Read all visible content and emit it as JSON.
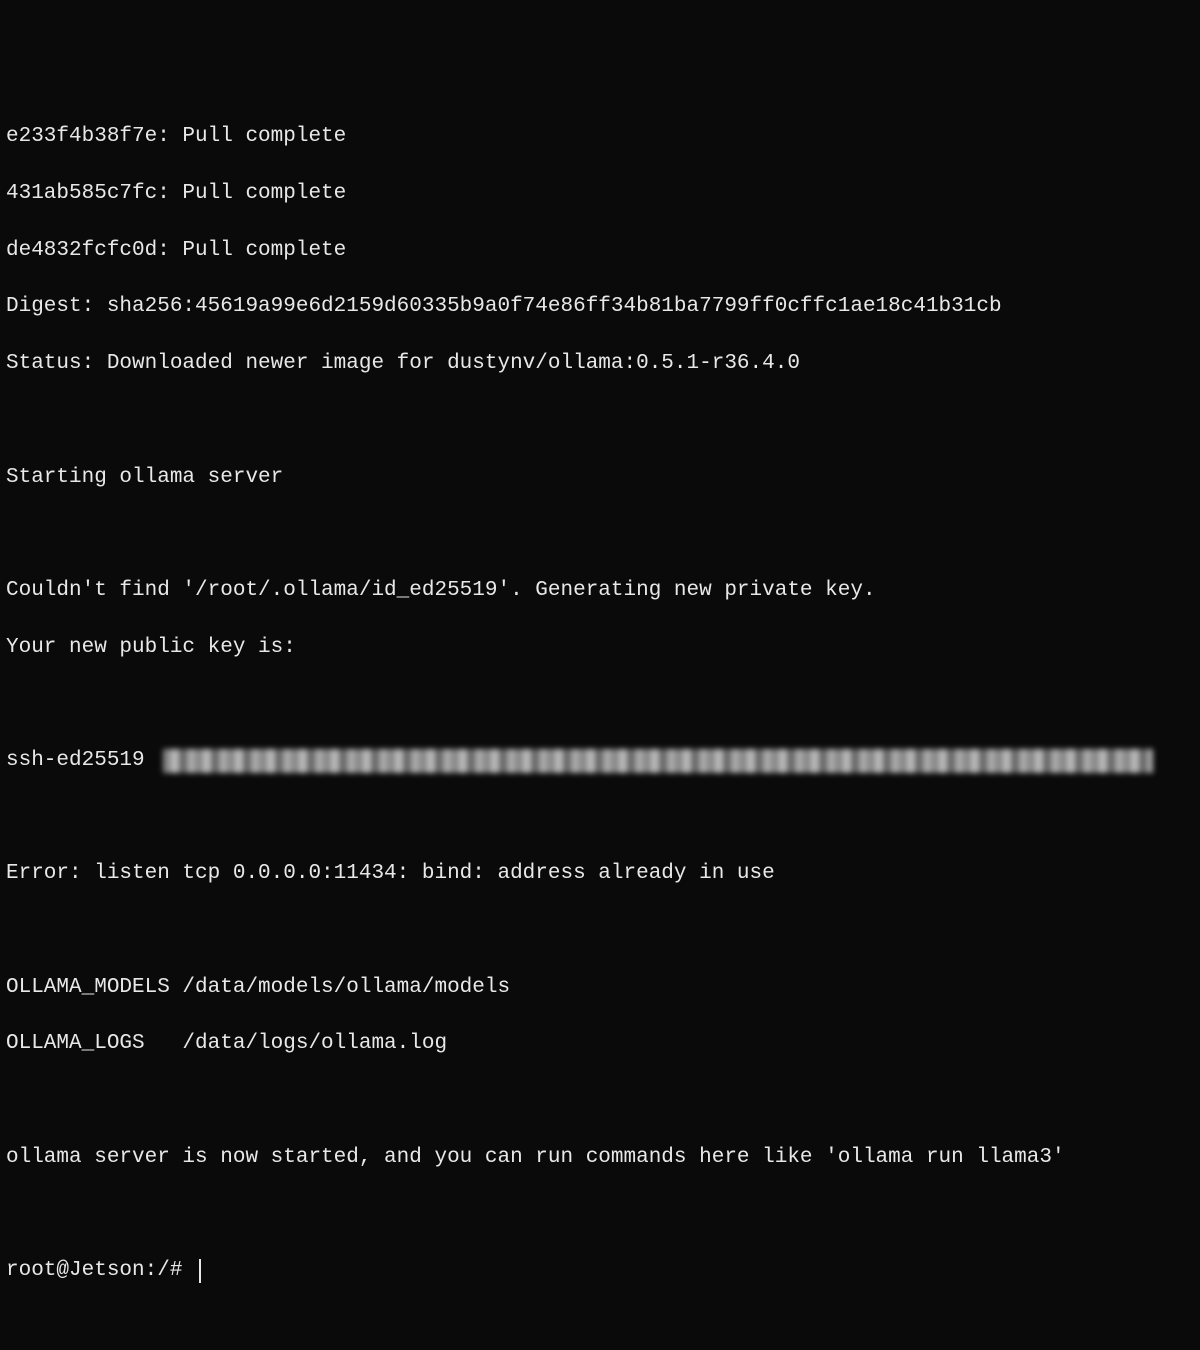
{
  "lines": {
    "pull1": "e233f4b38f7e: Pull complete",
    "pull2": "431ab585c7fc: Pull complete",
    "pull3": "de4832fcfc0d: Pull complete",
    "digest": "Digest: sha256:45619a99e6d2159d60335b9a0f74e86ff34b81ba7799ff0cffc1ae18c41b31cb",
    "status": "Status: Downloaded newer image for dustynv/ollama:0.5.1-r36.4.0",
    "starting": "Starting ollama server",
    "notfound": "Couldn't find '/root/.ollama/id_ed25519'. Generating new private key.",
    "pubkey_label": "Your new public key is:",
    "ssh_prefix": "ssh-ed25519 ",
    "error": "Error: listen tcp 0.0.0.0:11434: bind: address already in use",
    "models": "OLLAMA_MODELS /data/models/ollama/models",
    "logs": "OLLAMA_LOGS   /data/logs/ollama.log",
    "started": "ollama server is now started, and you can run commands here like 'ollama run llama3'",
    "prompt": "root@Jetson:/# "
  }
}
